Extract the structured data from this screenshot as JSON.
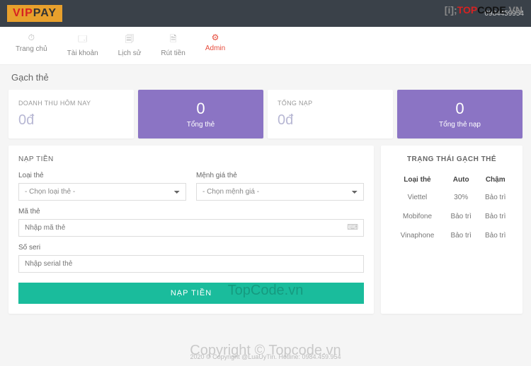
{
  "topbar": {
    "logo_v": "VIP",
    "logo_p": "PAY",
    "phone": "0984459954"
  },
  "brand": {
    "prefix": "[i];",
    "t": "TOP",
    "c": "CODE",
    "v": ".VN"
  },
  "nav": {
    "items": [
      {
        "label": "Trang chủ",
        "icon": "⏱"
      },
      {
        "label": "Tài khoản",
        "icon": "🗔"
      },
      {
        "label": "Lịch sử",
        "icon": "🗐"
      },
      {
        "label": "Rút tiền",
        "icon": "🗎"
      },
      {
        "label": "Admin",
        "icon": "⚙"
      }
    ]
  },
  "page": {
    "title": "Gạch thẻ"
  },
  "stats": {
    "revenue_label": "DOANH THU HÔM NAY",
    "revenue_value": "0đ",
    "cards_value": "0",
    "cards_label": "Tổng thẻ",
    "total_label": "TỔNG NẠP",
    "total_value": "0đ",
    "total_cards_value": "0",
    "total_cards_label": "Tổng thẻ nạp"
  },
  "form": {
    "title": "NẠP TIỀN",
    "card_type_label": "Loại thẻ",
    "card_type_placeholder": "- Chọn loại thẻ -",
    "denom_label": "Mệnh giá thẻ",
    "denom_placeholder": "- Chọn mệnh giá -",
    "code_label": "Mã thẻ",
    "code_placeholder": "Nhập mã thẻ",
    "serial_label": "Số seri",
    "serial_placeholder": "Nhập serial thẻ",
    "submit": "NẠP TIỀN"
  },
  "status": {
    "title": "TRẠNG THÁI GẠCH THẺ",
    "headers": [
      "Loại thẻ",
      "Auto",
      "Chậm"
    ],
    "rows": [
      [
        "Viettel",
        "30%",
        "Bảo trì"
      ],
      [
        "Mobifone",
        "Bảo trì",
        "Bảo trì"
      ],
      [
        "Vinaphone",
        "Bảo trì",
        "Bảo trì"
      ]
    ]
  },
  "footer": {
    "text": "2020 © Copyright @LuaUyTin. Hotline: 0984.459.954"
  },
  "watermark": {
    "text1": "TopCode.vn",
    "text2": "Copyright © Topcode.vn"
  }
}
